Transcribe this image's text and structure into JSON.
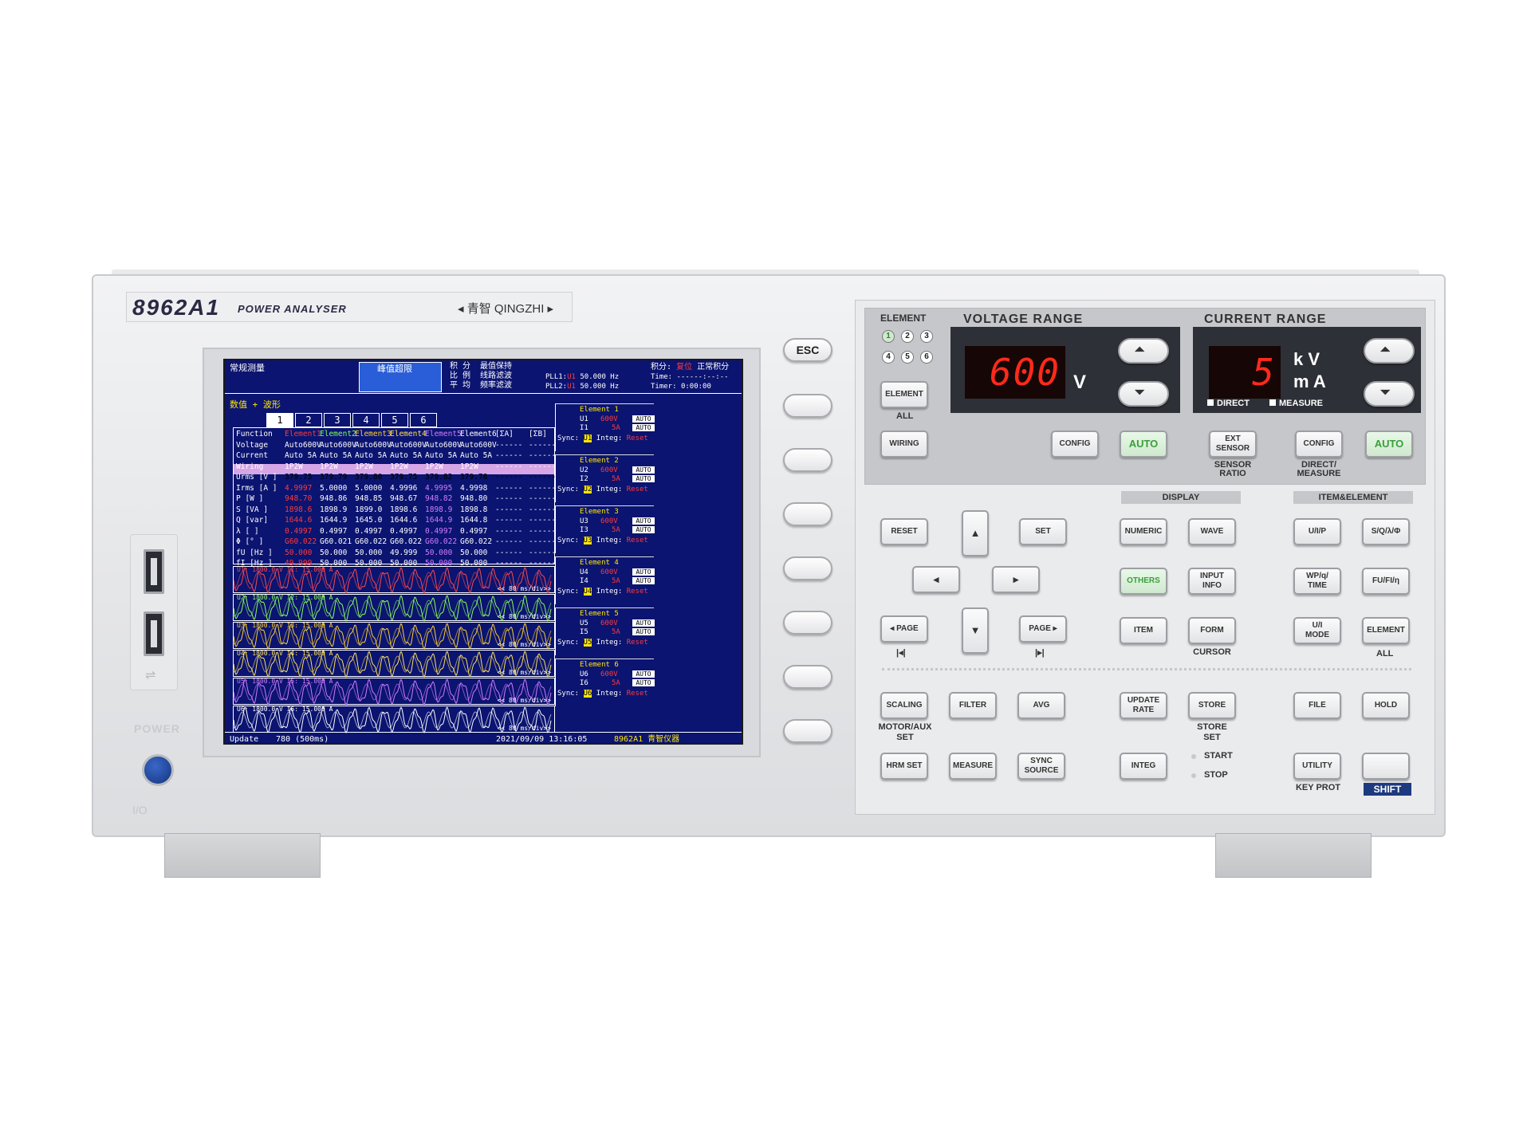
{
  "device": {
    "model": "8962A1",
    "model_sub": "POWER ANALYSER",
    "brand": "◂ 青智 QINGZHI ▸",
    "power_label": "POWER",
    "onoff_label": "I/O"
  },
  "screen": {
    "header": {
      "mode": "常规测量",
      "peak_over": "峰值超限",
      "flags_col1": [
        "积 分",
        "比 例",
        "平 均"
      ],
      "flags_col2": [
        "最值保持",
        "线路滤波",
        "频率滤波"
      ],
      "pll1_label": "PLL1:",
      "pll1_src": "U1",
      "pll1_val": "50.000 Hz",
      "pll2_label": "PLL2:",
      "pll2_src": "U1",
      "pll2_val": "50.000 Hz",
      "integ_label": "积分:",
      "integ_state": "复位",
      "integ_mode": "正常积分",
      "time_label": "Time:",
      "time_val": "------:--:--",
      "timer_label": "Timer:",
      "timer_val": "0:00:00"
    },
    "view_label": "数值 + 波形",
    "tabs": [
      "1",
      "2",
      "3",
      "4",
      "5",
      "6"
    ],
    "table": {
      "row_labels": [
        "Function",
        "Voltage",
        "Current",
        "Wiring",
        "Urms [V  ]",
        "Irms [A  ]",
        "P    [W  ]",
        "S    [VA ]",
        "Q    [var]",
        "λ    [   ]",
        "Φ    [°  ]",
        "fU   [Hz ]",
        "fI   [Hz ]"
      ],
      "columns": [
        {
          "name": "Element1",
          "color": "#ff3a3a",
          "cells": [
            "Auto600V",
            "Auto  5A",
            "1P2W",
            "379.75",
            "4.9997",
            "948.70",
            "1898.6",
            "1644.6",
            "0.4997",
            "G60.022",
            "50.000",
            "49.999"
          ]
        },
        {
          "name": "Element2",
          "color": "#7dff5a",
          "cells": [
            "Auto600V",
            "Auto  5A",
            "1P2W",
            "379.79",
            "5.0000",
            "948.86",
            "1898.9",
            "1644.9",
            "0.4997",
            "G60.021",
            "50.000",
            "50.000"
          ]
        },
        {
          "name": "Element3",
          "color": "#ffd030",
          "cells": [
            "Auto600V",
            "Auto  5A",
            "1P2W",
            "379.80",
            "5.0000",
            "948.85",
            "1899.0",
            "1645.0",
            "0.4997",
            "G60.022",
            "50.000",
            "50.000"
          ]
        },
        {
          "name": "Element4",
          "color": "#ffe25a",
          "cells": [
            "Auto600V",
            "Auto  5A",
            "1P2W",
            "379.75",
            "4.9996",
            "948.67",
            "1898.6",
            "1644.6",
            "0.4997",
            "G60.022",
            "49.999",
            "50.000"
          ]
        },
        {
          "name": "Element5",
          "color": "#d27cff",
          "cells": [
            "Auto600V",
            "Auto  5A",
            "1P2W",
            "379.82",
            "4.9995",
            "948.82",
            "1898.9",
            "1644.9",
            "0.4997",
            "G60.022",
            "50.000",
            "50.000"
          ]
        },
        {
          "name": "Element6",
          "color": "#ffffff",
          "cells": [
            "Auto600V",
            "Auto  5A",
            "1P2W",
            "379.78",
            "4.9998",
            "948.80",
            "1898.8",
            "1644.8",
            "0.4997",
            "G60.022",
            "50.000",
            "50.000"
          ]
        },
        {
          "name": "[ΣA]",
          "color": "#ffffff",
          "cells": [
            "------",
            "------",
            "------",
            "------",
            "------",
            "------",
            "------",
            "------",
            "------",
            "------",
            "------",
            "------"
          ]
        },
        {
          "name": "[ΣB]",
          "color": "#ffffff",
          "cells": [
            "------",
            "------",
            "------",
            "------",
            "------",
            "------",
            "------",
            "------",
            "------",
            "------",
            "------",
            "------"
          ]
        }
      ]
    },
    "elements": [
      {
        "title": "Element 1",
        "u": "U1",
        "i": "I1",
        "v_range": "600V",
        "i_range": "5A",
        "auto": "AUTO",
        "sync_label": "Sync:",
        "sync": "U1",
        "integ_label": "Integ:",
        "integ": "Reset"
      },
      {
        "title": "Element 2",
        "u": "U2",
        "i": "I2",
        "v_range": "600V",
        "i_range": "5A",
        "auto": "AUTO",
        "sync_label": "Sync:",
        "sync": "U2",
        "integ_label": "Integ:",
        "integ": "Reset"
      },
      {
        "title": "Element 3",
        "u": "U3",
        "i": "I3",
        "v_range": "600V",
        "i_range": "5A",
        "auto": "AUTO",
        "sync_label": "Sync:",
        "sync": "U3",
        "integ_label": "Integ:",
        "integ": "Reset"
      },
      {
        "title": "Element 4",
        "u": "U4",
        "i": "I4",
        "v_range": "600V",
        "i_range": "5A",
        "auto": "AUTO",
        "sync_label": "Sync:",
        "sync": "U4",
        "integ_label": "Integ:",
        "integ": "Reset"
      },
      {
        "title": "Element 5",
        "u": "U5",
        "i": "I5",
        "v_range": "600V",
        "i_range": "5A",
        "auto": "AUTO",
        "sync_label": "Sync:",
        "sync": "U5",
        "integ_label": "Integ:",
        "integ": "Reset"
      },
      {
        "title": "Element 6",
        "u": "U6",
        "i": "I6",
        "v_range": "600V",
        "i_range": "5A",
        "auto": "AUTO",
        "sync_label": "Sync:",
        "sync": "U6",
        "integ_label": "Integ:",
        "integ": "Reset"
      }
    ],
    "waves": [
      {
        "label": "U1: 1800.0 V  I1: 15.000 A",
        "color": "#ff4a4a",
        "div": "<< 80 ms/div>>"
      },
      {
        "label": "U2: 1800.0 V  I2: 15.000 A",
        "color": "#8dff5a",
        "div": "<< 80 ms/div>>"
      },
      {
        "label": "U3: 1800.0 V  I3: 15.000 A",
        "color": "#ffd030",
        "div": "<< 80 ms/div>>"
      },
      {
        "label": "U4: 1800.0 V  I4: 15.000 A",
        "color": "#ffe25a",
        "div": "<< 80 ms/div>>"
      },
      {
        "label": "U5: 1800.0 V  I5: 15.000 A",
        "color": "#d27cff",
        "div": "<< 80 ms/div>>"
      },
      {
        "label": "U6: 1800.0 V  I6: 15.000 A",
        "color": "#ffffff",
        "div": "<< 80 ms/div>>"
      }
    ],
    "status": {
      "update_label": "Update",
      "update_val": "780 (500ms)",
      "datetime": "2021/09/09  13:16:05",
      "footer_brand": "8962A1  青智仪器"
    }
  },
  "softkeys": {
    "esc": "ESC"
  },
  "panel": {
    "element_hdr": "ELEMENT",
    "element_nums": [
      "1",
      "2",
      "3",
      "4",
      "5",
      "6"
    ],
    "element_btn": "ELEMENT",
    "element_all": "ALL",
    "wiring_btn": "WIRING",
    "voltage_hdr": "VOLTAGE RANGE",
    "voltage_value": "600",
    "voltage_unit": "V",
    "current_hdr": "CURRENT RANGE",
    "current_value": "5",
    "current_unit_top": "k V",
    "current_unit_bot": "m A",
    "direct_lbl": "DIRECT",
    "measure_lbl": "MEASURE",
    "config_v": "CONFIG",
    "auto_v": "AUTO",
    "ext_sensor_1": "EXT",
    "ext_sensor_2": "SENSOR",
    "sensor_ratio_1": "SENSOR",
    "sensor_ratio_2": "RATIO",
    "config_c": "CONFIG",
    "direct_measure_1": "DIRECT/",
    "direct_measure_2": "MEASURE",
    "auto_c": "AUTO",
    "reset": "RESET",
    "set": "SET",
    "page_left": "◂ PAGE",
    "page_right": "PAGE ▸",
    "page_left_sub": "|◂|",
    "page_right_sub": "|▸|",
    "display_hdr": "DISPLAY",
    "numeric": "NUMERIC",
    "wave": "WAVE",
    "others": "OTHERS",
    "input_info_1": "INPUT",
    "input_info_2": "INFO",
    "item": "ITEM",
    "form": "FORM",
    "cursor": "CURSOR",
    "itemel_hdr": "ITEM&ELEMENT",
    "uip": "U/I/P",
    "sqlp": "S/Q/λ/Φ",
    "wp_1": "WP/q/",
    "wp_2": "TIME",
    "fufi": "FU/FI/η",
    "ui_mode_1": "U/I",
    "ui_mode_2": "MODE",
    "element2": "ELEMENT",
    "all2": "ALL",
    "scaling": "SCALING",
    "motor_aux": "MOTOR/AUX",
    "motor_set": "SET",
    "filter": "FILTER",
    "avg": "AVG",
    "update_rate_1": "UPDATE",
    "update_rate_2": "RATE",
    "store": "STORE",
    "store_set_1": "STORE",
    "store_set_2": "SET",
    "file": "FILE",
    "hold": "HOLD",
    "hrm_set": "HRM SET",
    "measure": "MEASURE",
    "sync_source_1": "SYNC",
    "sync_source_2": "SOURCE",
    "integ": "INTEG",
    "start": "START",
    "stop": "STOP",
    "utility": "UTILITY",
    "key_prot": "KEY PROT",
    "shift": "SHIFT"
  }
}
